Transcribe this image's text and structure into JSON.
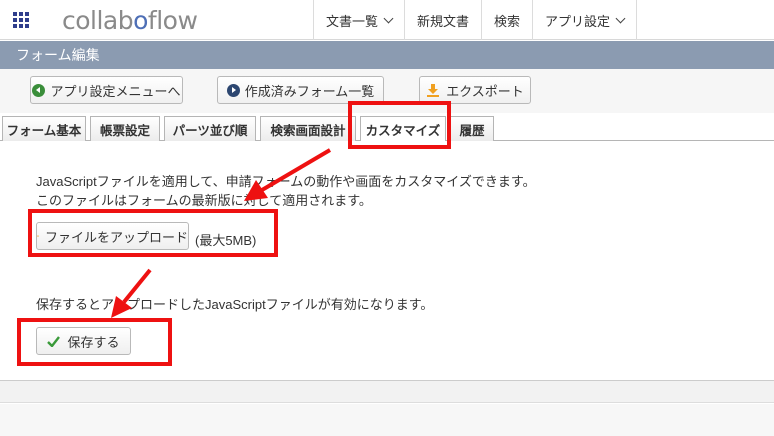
{
  "header": {
    "logo_prefix": "collab",
    "logo_o": "o",
    "logo_suffix": "flow",
    "nav": [
      {
        "label": "文書一覧"
      },
      {
        "label": "新規文書"
      },
      {
        "label": "検索"
      },
      {
        "label": "アプリ設定"
      }
    ]
  },
  "page": {
    "title": "フォーム編集"
  },
  "toolbar": {
    "app_menu": "アプリ設定メニューへ",
    "created_forms": "作成済みフォーム一覧",
    "export": "エクスポート"
  },
  "tabs": [
    {
      "label": "フォーム基本"
    },
    {
      "label": "帳票設定"
    },
    {
      "label": "パーツ並び順"
    },
    {
      "label": "検索画面設計"
    },
    {
      "label": "カスタマイズ"
    },
    {
      "label": "履歴"
    }
  ],
  "content": {
    "desc_line1": "JavaScriptファイルを適用して、申請フォームの動作や画面をカスタマイズできます。",
    "desc_line2": "このファイルはフォームの最新版に対して適用されます。",
    "upload_label": "ファイルをアップロード",
    "max_size": "(最大5MB)",
    "note": "保存するとアップロードしたJavaScriptファイルが有効になります。",
    "save_label": "保存する"
  },
  "colors": {
    "title_bar": "#8b9bb1",
    "annotation_red": "#ee1111",
    "accent_blue": "#2f3d8c",
    "save_check": "#3a9a3a",
    "upload_orange": "#f0a020"
  }
}
